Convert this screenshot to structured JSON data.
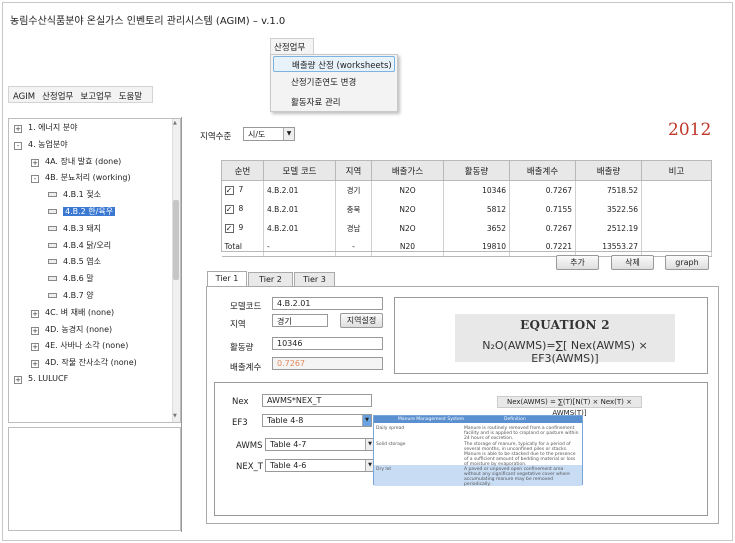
{
  "window": {
    "title": "농림수산식품분야 온실가스 인벤토리 관리시스템 (AGIM) – v.1.0"
  },
  "menubar": {
    "items": [
      "AGIM",
      "산정업무",
      "보고업무",
      "도움말"
    ]
  },
  "dropdown": {
    "header": "산정업무",
    "items": [
      "배출량 산정 (worksheets)",
      "산정기준연도 변경",
      "활동자료 관리"
    ],
    "selected_index": 0
  },
  "tree": {
    "items": [
      {
        "label": "1. 에너지 분야",
        "level": 0,
        "toggle": "+"
      },
      {
        "label": "4. 농업분야",
        "level": 0,
        "toggle": "-"
      },
      {
        "label": "4A. 장내 발효 (done)",
        "level": 1,
        "toggle": "+"
      },
      {
        "label": "4B. 분뇨처리 (working)",
        "level": 1,
        "toggle": "-"
      },
      {
        "label": "4.B.1 젖소",
        "level": 2,
        "toggle": ""
      },
      {
        "label": "4.B.2 한/육우",
        "level": 2,
        "toggle": "",
        "selected": true
      },
      {
        "label": "4.B.3 돼지",
        "level": 2,
        "toggle": ""
      },
      {
        "label": "4.B.4 닭/오리",
        "level": 2,
        "toggle": ""
      },
      {
        "label": "4.B.5 염소",
        "level": 2,
        "toggle": ""
      },
      {
        "label": "4.B.6 말",
        "level": 2,
        "toggle": ""
      },
      {
        "label": "4.B.7 양",
        "level": 2,
        "toggle": ""
      },
      {
        "label": "4C. 벼 재배 (none)",
        "level": 1,
        "toggle": "+"
      },
      {
        "label": "4D. 농경지 (none)",
        "level": 1,
        "toggle": "+"
      },
      {
        "label": "4E. 사바나 소각 (none)",
        "level": 1,
        "toggle": "+"
      },
      {
        "label": "4D. 작물 잔사소각 (none)",
        "level": 1,
        "toggle": "+"
      },
      {
        "label": "5. LULUCF",
        "level": 0,
        "toggle": "+"
      }
    ]
  },
  "year": "2012",
  "region_filter": {
    "label": "지역수준",
    "value": "시/도"
  },
  "table": {
    "headers": [
      "순번",
      "모델 코드",
      "지역",
      "배출가스",
      "활동량",
      "배출계수",
      "배출량",
      "비고"
    ],
    "rows": [
      {
        "checked": "✓",
        "no": "7",
        "code": "4.B.2.01",
        "region": "경기",
        "gas": "N2O",
        "activity": "10346",
        "factor": "0.7267",
        "emission": "7518.52",
        "note": ""
      },
      {
        "checked": "✓",
        "no": "8",
        "code": "4.B.2.01",
        "region": "충북",
        "gas": "N2O",
        "activity": "5812",
        "factor": "0.7155",
        "emission": "3522.56",
        "note": ""
      },
      {
        "checked": "✓",
        "no": "9",
        "code": "4.B.2.01",
        "region": "경남",
        "gas": "N2O",
        "activity": "3652",
        "factor": "0.7267",
        "emission": "2512.19",
        "note": ""
      }
    ],
    "total": {
      "no": "Total",
      "code": "-",
      "region": "-",
      "gas": "N20",
      "activity": "19810",
      "factor": "0.7221",
      "emission": "13553.27",
      "note": ""
    }
  },
  "buttons": {
    "add": "추가",
    "delete": "삭제",
    "graph": "graph"
  },
  "tabs": [
    "Tier 1",
    "Tier 2",
    "Tier 3"
  ],
  "form": {
    "model_code_label": "모델코드",
    "model_code": "4.B.2.01",
    "region_label": "지역",
    "region": "경기",
    "region_button": "지역설정",
    "activity_label": "활동량",
    "activity": "10346",
    "factor_label": "배출계수",
    "factor": "0.7267"
  },
  "equation": {
    "title": "EQUATION 2",
    "formula": "N₂O(AWMS)=∑[ Nex(AWMS) × EF3(AWMS)]"
  },
  "nex_equation": "Nex(AWMS) = ∑(T)[N(T) × Nex(T) × AWMS(T)]",
  "params": {
    "nex_label": "Nex",
    "nex_value": "AWMS*NEX_T",
    "ef3_label": "EF3",
    "ef3_value": "Table 4-8",
    "awms_label": "AWMS",
    "awms_value": "Table 4-7",
    "next_label": "NEX_T",
    "next_value": "Table 4-6"
  },
  "popup": {
    "col1": "Manure Management System",
    "col2": "Definition",
    "rows": [
      {
        "sys": "Daily spread",
        "def": "Manure is routinely removed from a confinement facility and is applied to cropland or pasture within 24 hours of excretion."
      },
      {
        "sys": "Solid storage",
        "def": "The storage of manure, typically for a period of several months, in unconfined piles or stacks. Manure is able to be stacked due to the presence of a sufficient amount of bedding material or loss of moisture by evaporation."
      },
      {
        "sys": "Dry lot",
        "def": "A paved or unpaved open confinement area without any significant vegetative cover where accumulating manure may be removed periodically."
      }
    ]
  },
  "colors": {
    "accent_year": "#c0392b",
    "selection": "#3a78d2",
    "factor_text": "#e08a5a"
  }
}
